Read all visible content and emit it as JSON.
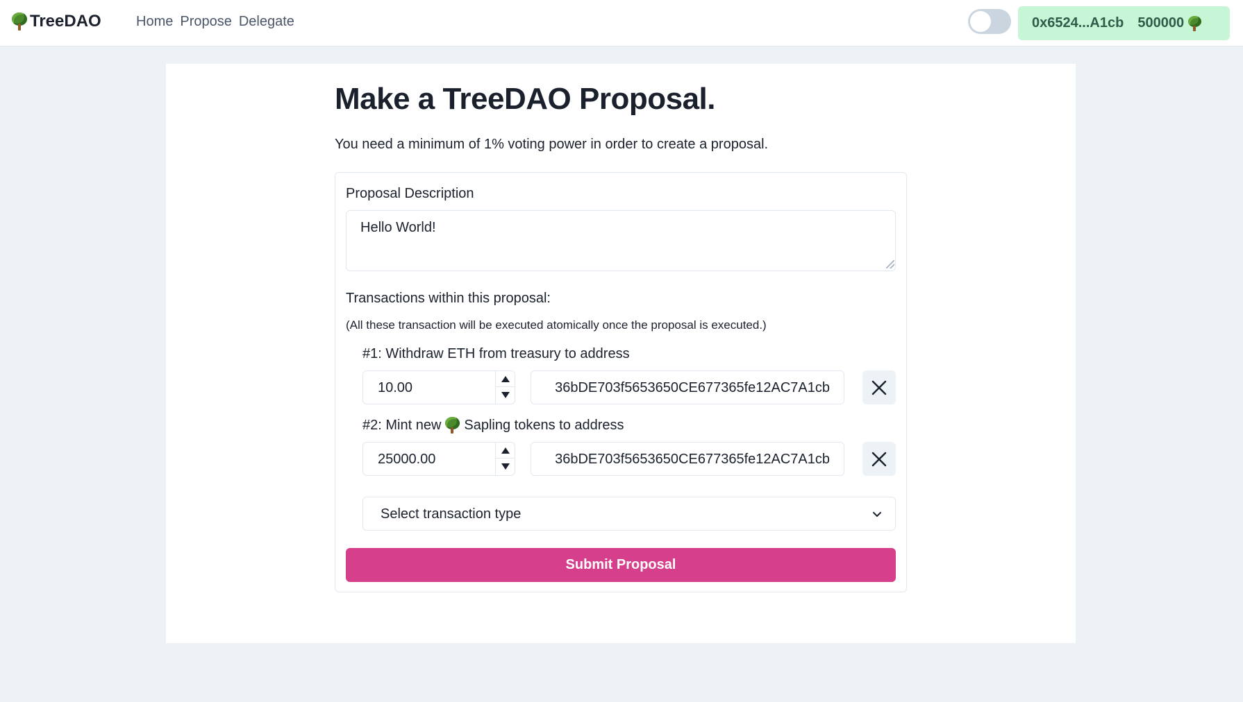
{
  "header": {
    "brand": "TreeDAO",
    "brand_icon": "tree-emoji",
    "nav": [
      "Home",
      "Propose",
      "Delegate"
    ],
    "theme_toggle_on": false,
    "account_address": "0x6524...A1cb",
    "account_balance": "500000",
    "balance_icon": "tree-emoji"
  },
  "main": {
    "title": "Make a TreeDAO Proposal.",
    "subtitle": "You need a minimum of 1% voting power in order to create a proposal.",
    "description_label": "Proposal Description",
    "description_value": "Hello World!",
    "transactions_heading": "Transactions within this proposal:",
    "transactions_note": "(All these transaction will be executed atomically once the proposal is executed.)",
    "transactions": [
      {
        "label": "#1: Withdraw ETH from treasury to address",
        "amount": "10.00",
        "address": "36bDE703f5653650CE677365fe12AC7A1cb"
      },
      {
        "label_prefix": "#2: Mint new",
        "label_suffix": "Sapling tokens to address",
        "amount": "25000.00",
        "address": "36bDE703f5653650CE677365fe12AC7A1cb"
      }
    ],
    "select_placeholder": "Select transaction type",
    "submit_label": "Submit Proposal"
  },
  "colors": {
    "accent": "#d53f8c",
    "account_bg": "#c6f6d5",
    "page_bg": "#edf2f7"
  }
}
